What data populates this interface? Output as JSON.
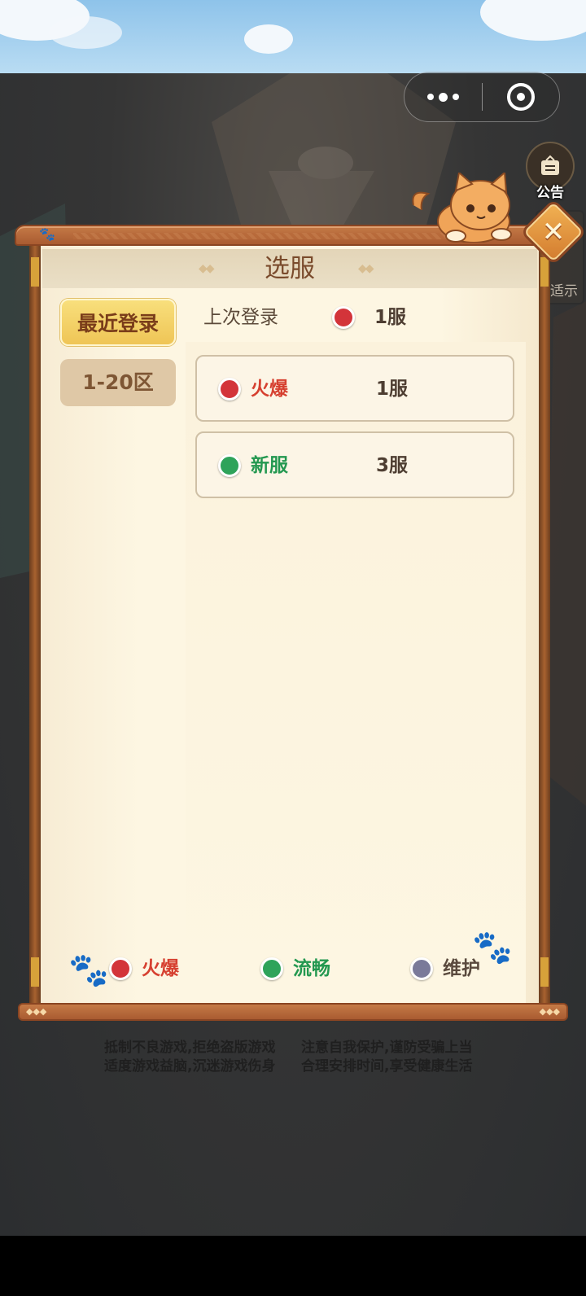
{
  "dialog": {
    "title": "选服",
    "tabs": [
      {
        "label": "最近登录",
        "active": true
      },
      {
        "label": "1-20区",
        "active": false
      }
    ],
    "last_login": {
      "label": "上次登录",
      "status": "hot",
      "server": "1服"
    },
    "servers": [
      {
        "status": "hot",
        "status_text": "火爆",
        "name": "1服"
      },
      {
        "status": "new",
        "status_text": "新服",
        "name": "3服"
      }
    ],
    "legend": [
      {
        "status": "hot",
        "label": "火爆"
      },
      {
        "status": "smooth",
        "label": "流畅"
      },
      {
        "status": "maintenance",
        "label": "维护"
      }
    ],
    "close_icon": "close-icon"
  },
  "hud": {
    "notice_label": "公告",
    "side_label": "适示"
  },
  "health_notice": {
    "left": [
      "抵制不良游戏,拒绝盗版游戏",
      "适度游戏益脑,沉迷游戏伤身"
    ],
    "right": [
      "注意自我保护,谨防受骗上当",
      "合理安排时间,享受健康生活"
    ]
  },
  "colors": {
    "hot": "#d3343a",
    "new": "#2ea35a",
    "maintenance": "#7a7a9a",
    "hot_text": "#d64030",
    "new_text": "#239850",
    "maintenance_text": "#5a4a3e"
  }
}
